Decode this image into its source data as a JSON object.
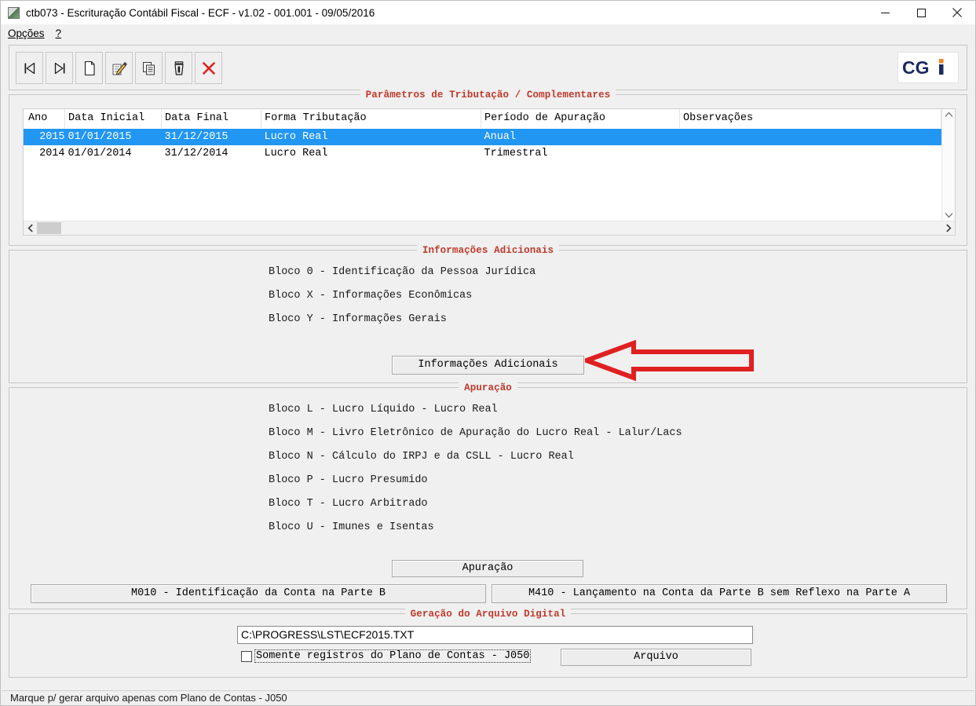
{
  "window": {
    "title": "ctb073 - Escrituração Contábil Fiscal - ECF - v1.02 - 001.001 - 09/05/2016",
    "icon": "app-icon",
    "minimize": "—",
    "maximize": "□",
    "close": "✕"
  },
  "menu": {
    "items": [
      {
        "label": "Opções",
        "accel": "O"
      },
      {
        "label": "?",
        "accel": "?"
      }
    ]
  },
  "toolbar": {
    "buttons": [
      {
        "name": "first-record-button",
        "icon": "first-record-icon",
        "tooltip": "Primeiro"
      },
      {
        "name": "last-record-button",
        "icon": "last-record-icon",
        "tooltip": "Último"
      },
      {
        "name": "new-record-button",
        "icon": "new-document-icon",
        "tooltip": "Novo"
      },
      {
        "name": "edit-record-button",
        "icon": "pencil-edit-icon",
        "tooltip": "Alterar"
      },
      {
        "name": "copy-record-button",
        "icon": "copy-icon",
        "tooltip": "Copiar"
      },
      {
        "name": "delete-record-button",
        "icon": "trash-icon",
        "tooltip": "Excluir"
      },
      {
        "name": "cancel-button",
        "icon": "red-x-icon",
        "tooltip": "Cancelar"
      }
    ],
    "logo": {
      "text": "CGi",
      "primary": "#1b2a5e",
      "accent": "#f5821f"
    }
  },
  "parametros": {
    "title": "Parâmetros de Tributação / Complementares",
    "columns": [
      "Ano",
      "Data Inicial",
      "Data Final",
      "Forma Tributação",
      "Período de Apuração",
      "Observações"
    ],
    "rows": [
      {
        "ano": "2015",
        "data_inicial": "01/01/2015",
        "data_final": "31/12/2015",
        "forma_tributacao": "Lucro Real",
        "periodo_apuracao": "Anual",
        "observacoes": "",
        "selected": true
      },
      {
        "ano": "2014",
        "data_inicial": "01/01/2014",
        "data_final": "31/12/2014",
        "forma_tributacao": "Lucro Real",
        "periodo_apuracao": "Trimestral",
        "observacoes": "",
        "selected": false
      }
    ],
    "selection_color": "#2196f3"
  },
  "informacoes_adicionais": {
    "title": "Informações Adicionais",
    "lines": [
      "Bloco 0 - Identificação da Pessoa Jurídica",
      "Bloco X - Informações Econômicas",
      "Bloco Y - Informações Gerais"
    ],
    "button_label": "Informações Adicionais",
    "arrow": {
      "name": "red-left-arrow",
      "color": "#e02020",
      "direction": "left"
    }
  },
  "apuracao": {
    "title": "Apuração",
    "lines": [
      "Bloco L - Lucro Líquido - Lucro Real",
      "Bloco M - Livro Eletrônico de Apuração do Lucro Real - Lalur/Lacs",
      "Bloco N - Cálculo do IRPJ e da CSLL - Lucro Real",
      "Bloco P - Lucro Presumido",
      "Bloco T - Lucro Arbitrado",
      "Bloco U - Imunes e Isentas"
    ],
    "button_label": "Apuração",
    "button_m010": "M010 - Identificação da Conta na Parte B",
    "button_m410": "M410 - Lançamento na Conta da Parte B sem Reflexo na Parte A"
  },
  "geracao": {
    "title": "Geração do Arquivo Digital",
    "path_value": "C:\\PROGRESS\\LST\\ECF2015.TXT",
    "checkbox_label": "Somente registros do Plano de Contas - J050",
    "checkbox_checked": false,
    "button_label": "Arquivo"
  },
  "statusbar": {
    "text": "Marque p/ gerar arquivo apenas com Plano de Contas - J050"
  }
}
